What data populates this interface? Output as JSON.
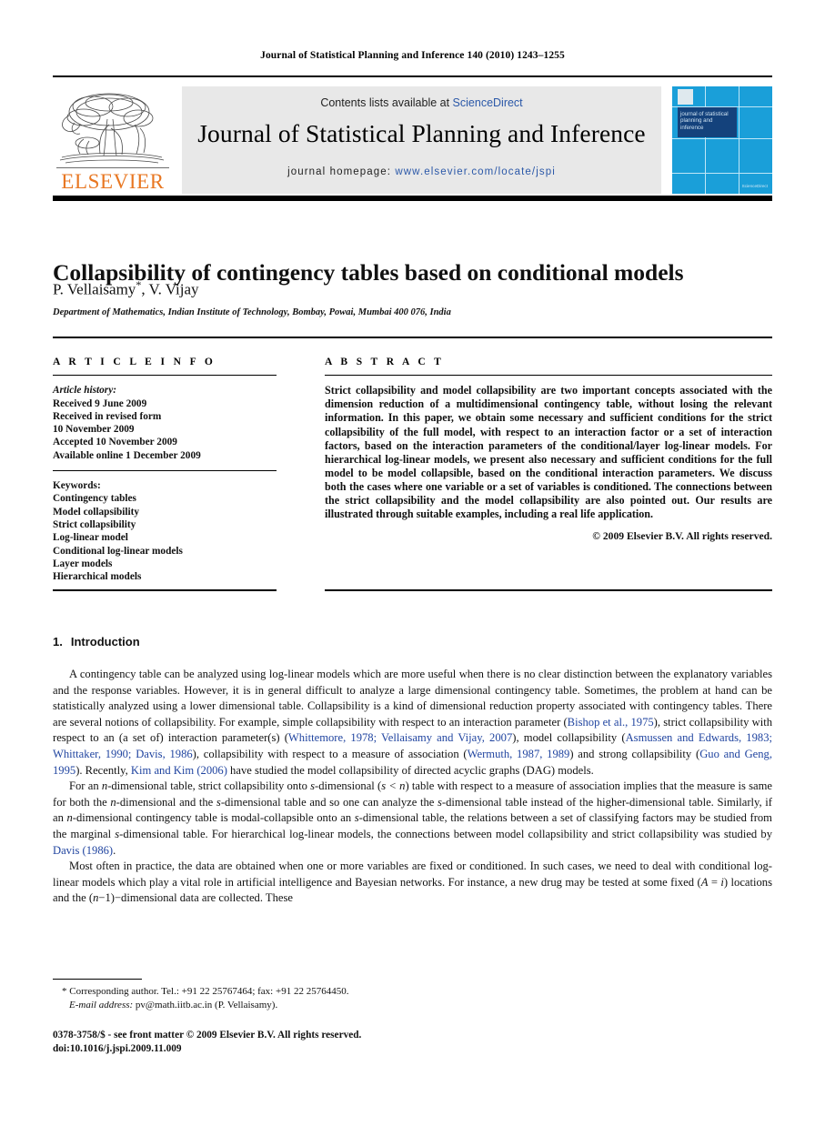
{
  "running_head": "Journal of Statistical Planning and Inference 140 (2010) 1243–1255",
  "masthead": {
    "contents_prefix": "Contents lists available at ",
    "contents_link": "ScienceDirect",
    "journal_title": "Journal of Statistical Planning and Inference",
    "homepage_prefix": "journal homepage: ",
    "homepage_url": "www.elsevier.com/locate/jspi",
    "publisher_name": "ELSEVIER",
    "cover": {
      "title_lines": "journal of statistical planning and inference",
      "footer_text": "ScienceDirect"
    }
  },
  "article": {
    "title": "Collapsibility of contingency tables based on conditional models",
    "authors": "P. Vellaisamy",
    "author_marker": "*",
    "authors_rest": ", V. Vijay",
    "affiliation": "Department of Mathematics, Indian Institute of Technology, Bombay, Powai, Mumbai 400 076, India"
  },
  "info": {
    "heading": "A R T I C L E   I N F O",
    "history_label": "Article history:",
    "history_lines": [
      "Received 9 June 2009",
      "Received in revised form",
      "10 November 2009",
      "Accepted 10 November 2009",
      "Available online 1 December 2009"
    ],
    "keywords_label": "Keywords:",
    "keywords": [
      "Contingency tables",
      "Model collapsibility",
      "Strict collapsibility",
      "Log-linear model",
      "Conditional log-linear models",
      "Layer models",
      "Hierarchical models"
    ]
  },
  "abstract": {
    "heading": "A B S T R A C T",
    "text": "Strict collapsibility and model collapsibility are two important concepts associated with the dimension reduction of a multidimensional contingency table, without losing the relevant information. In this paper, we obtain some necessary and sufficient conditions for the strict collapsibility of the full model, with respect to an interaction factor or a set of interaction factors, based on the interaction parameters of the conditional/layer log-linear models. For hierarchical log-linear models, we present also necessary and sufficient conditions for the full model to be model collapsible, based on the conditional interaction parameters. We discuss both the cases where one variable or a set of variables is conditioned. The connections between the strict collapsibility and the model collapsibility are also pointed out. Our results are illustrated through suitable examples, including a real life application.",
    "copyright": "© 2009 Elsevier B.V. All rights reserved."
  },
  "section": {
    "number": "1.",
    "title": "Introduction"
  },
  "body": {
    "p1": {
      "a": "A contingency table can be analyzed using log-linear models which are more useful when there is no clear distinction between the explanatory variables and the response variables. However, it is in general difficult to analyze a large dimensional contingency table. Sometimes, the problem at hand can be statistically analyzed using a lower dimensional table. Collapsibility is a kind of dimensional reduction property associated with contingency tables. There are several notions of collapsibility. For example, simple collapsibility with respect to an interaction parameter (",
      "c1": "Bishop et al., 1975",
      "b": "), strict collapsibility with respect to an (a set of) interaction parameter(s) (",
      "c2": "Whittemore, 1978; Vellaisamy and Vijay, 2007",
      "c": "), model collapsibility (",
      "c3": "Asmussen and Edwards, 1983; Whittaker, 1990; Davis, 1986",
      "d": "), collapsibility with respect to a measure of association (",
      "c4": "Wermuth, 1987, 1989",
      "e": ") and strong collapsibility (",
      "c5": "Guo and Geng, 1995",
      "f": "). Recently, ",
      "c6": "Kim and Kim (2006)",
      "g": " have studied the model collapsibility of directed acyclic graphs (DAG) models."
    },
    "p2": {
      "a": "For an ",
      "i1": "n",
      "b": "-dimensional table, strict collapsibility onto ",
      "i2": "s",
      "c": "-dimensional (",
      "i3": "s < n",
      "d": ") table with respect to a measure of association implies that the measure is same for both the ",
      "i4": "n",
      "e": "-dimensional and the ",
      "i5": "s",
      "f": "-dimensional table and so one can analyze the ",
      "i6": "s",
      "g": "-dimensional table instead of the higher-dimensional table. Similarly, if an ",
      "i7": "n",
      "h": "-dimensional contingency table is modal-collapsible onto an ",
      "i8": "s",
      "i": "-dimensional table, the relations between a set of classifying factors may be studied from the marginal ",
      "i9": "s",
      "j": "-dimensional table. For hierarchical log-linear models, the connections between model collapsibility and strict collapsibility was studied by ",
      "c1": "Davis (1986)",
      "k": "."
    },
    "p3": {
      "a": "Most often in practice, the data are obtained when one or more variables are fixed or conditioned. In such cases, we need to deal with conditional log-linear models which play a vital role in artificial intelligence and Bayesian networks. For instance, a new drug may be tested at some fixed (",
      "i1": "A",
      "b": " = ",
      "i2": "i",
      "c": ") locations and the (",
      "i3": "n",
      "d": "−1)−dimensional data are collected. These"
    }
  },
  "footnote": {
    "marker": "*",
    "corresponding": "Corresponding author. Tel.: +91 22 25767464; fax: +91 22 25764450.",
    "email_label": "E-mail address:",
    "email": "pv@math.iitb.ac.in (P. Vellaisamy)."
  },
  "imprint": {
    "issn_line": "0378-3758/$ - see front matter © 2009 Elsevier B.V. All rights reserved.",
    "doi_line": "doi:10.1016/j.jspi.2009.11.009"
  },
  "colors": {
    "link": "#2b58a8",
    "citation": "#2145a0",
    "elsevier_orange": "#E87722",
    "masthead_bg": "#e8e8e8",
    "cover_blue": "#1a9fd9"
  }
}
